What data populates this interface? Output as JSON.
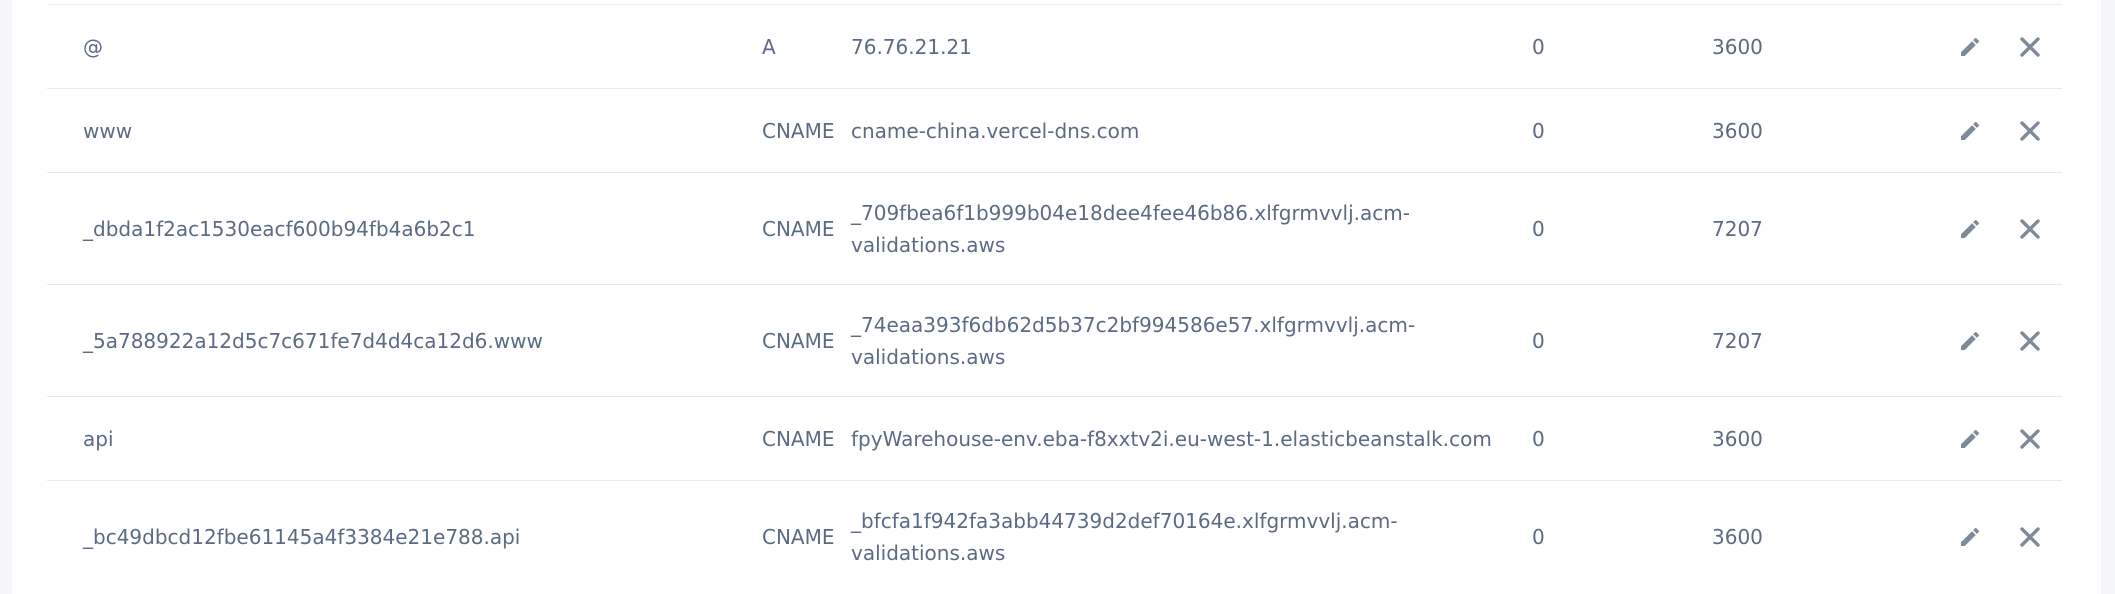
{
  "dns_records": [
    {
      "host": "@",
      "type": "A",
      "value": "76.76.21.21",
      "priority": "0",
      "ttl": "3600"
    },
    {
      "host": "www",
      "type": "CNAME",
      "value": "cname-china.vercel-dns.com",
      "priority": "0",
      "ttl": "3600"
    },
    {
      "host": "_dbda1f2ac1530eacf600b94fb4a6b2c1",
      "type": "CNAME",
      "value_line1": "_709fbea6f1b999b04e18dee4fee46b86.xlfgrmvvlj.acm-",
      "value_line2": "validations.aws",
      "priority": "0",
      "ttl": "7207"
    },
    {
      "host": "_5a788922a12d5c7c671fe7d4d4ca12d6.www",
      "type": "CNAME",
      "value_line1": "_74eaa393f6db62d5b37c2bf994586e57.xlfgrmvvlj.acm-",
      "value_line2": "validations.aws",
      "priority": "0",
      "ttl": "7207"
    },
    {
      "host": "api",
      "type": "CNAME",
      "value": "fpyWarehouse-env.eba-f8xxtv2i.eu-west-1.elasticbeanstalk.com",
      "priority": "0",
      "ttl": "3600"
    },
    {
      "host": "_bc49dbcd12fbe61145a4f3384e21e788.api",
      "type": "CNAME",
      "value_line1": "_bfcfa1f942fa3abb44739d2def70164e.xlfgrmvvlj.acm-",
      "value_line2": "validations.aws",
      "priority": "0",
      "ttl": "3600"
    }
  ],
  "icons": {
    "edit": "pencil-icon",
    "delete": "close-icon"
  },
  "colors": {
    "text": "#5b6b84",
    "icon": "#7f8a98",
    "divider": "#e6eaf0",
    "page_background": "#f4f6fa",
    "panel_background": "#ffffff"
  }
}
